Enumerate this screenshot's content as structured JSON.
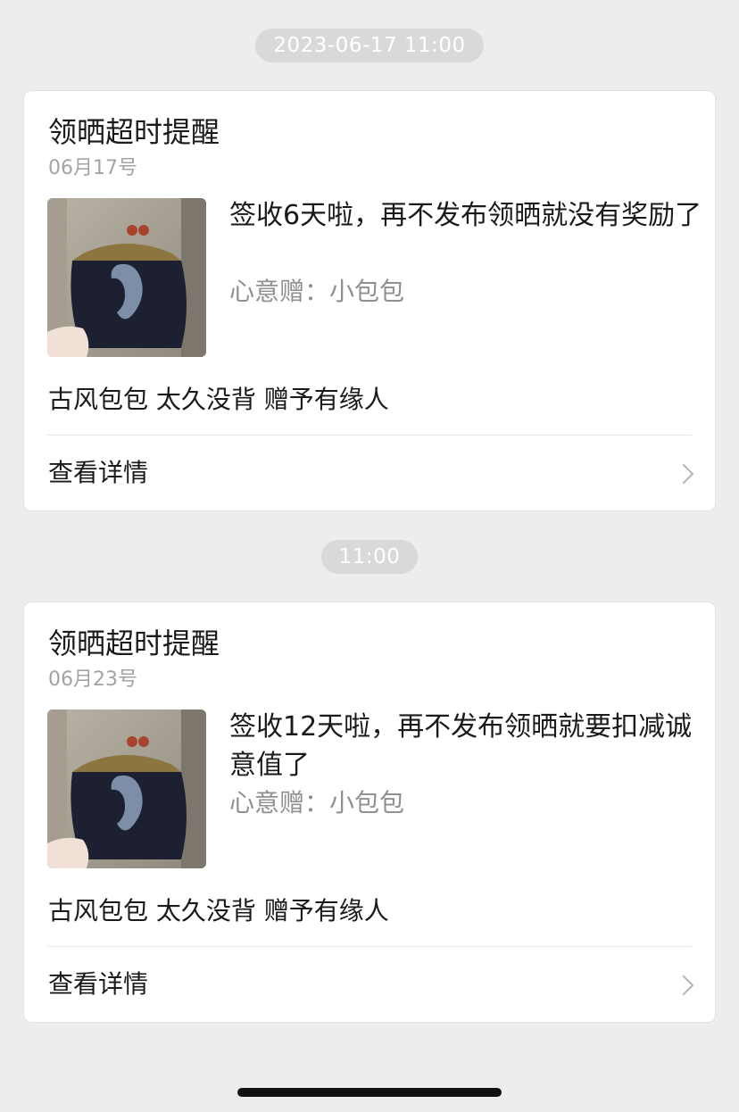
{
  "messages": [
    {
      "timestamp": "2023-06-17 11:00",
      "title": "领晒超时提醒",
      "date": "06月17号",
      "body": "签收6天啦，再不发布领晒就没有奖励了",
      "gift": "心意赠：小包包",
      "description": "古风包包 太久没背 赠予有缘人",
      "action_label": "查看详情",
      "thumbnail_icon": "handbag-photo"
    },
    {
      "timestamp": "11:00",
      "title": "领晒超时提醒",
      "date": "06月23号",
      "body": "签收12天啦，再不发布领晒就要扣减诚意值了",
      "gift": "心意赠：小包包",
      "description": "古风包包 太久没背 赠予有缘人",
      "action_label": "查看详情",
      "thumbnail_icon": "handbag-photo"
    }
  ],
  "colors": {
    "background": "#ededed",
    "card": "#ffffff",
    "timestamp_pill": "#d9d9d9",
    "secondary_text": "#a3a3a3"
  }
}
